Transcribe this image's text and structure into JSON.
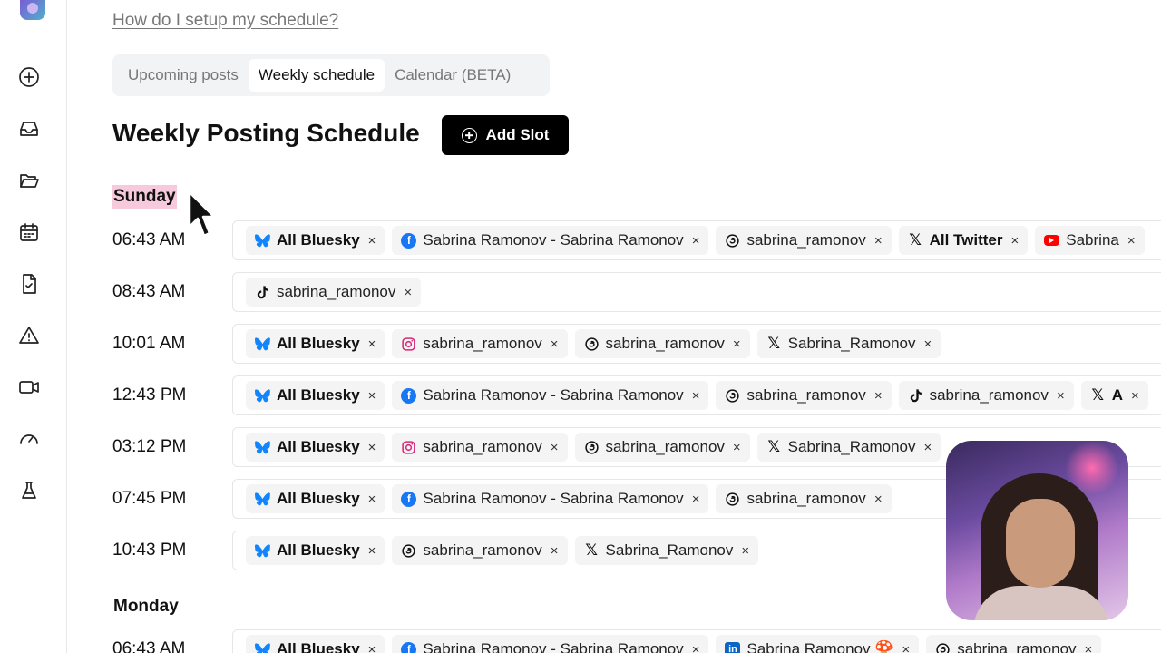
{
  "help_link": "How do I setup my schedule?",
  "tabs": [
    {
      "label": "Upcoming posts",
      "active": false
    },
    {
      "label": "Weekly schedule",
      "active": true
    },
    {
      "label": "Calendar (BETA)",
      "active": false
    }
  ],
  "page_title": "Weekly Posting Schedule",
  "add_slot_label": "Add Slot",
  "sidebar_icons": [
    "plus-circle-icon",
    "inbox-icon",
    "folder-open-icon",
    "calendar-icon",
    "file-check-icon",
    "warning-icon",
    "video-icon",
    "gauge-icon",
    "flask-icon"
  ],
  "days": [
    {
      "name": "Sunday",
      "slots": [
        {
          "time": "06:43 AM",
          "channels": [
            {
              "icon": "bluesky-icon",
              "label": "All Bluesky",
              "bold": true
            },
            {
              "icon": "facebook-icon",
              "label": "Sabrina Ramonov - Sabrina Ramonov",
              "bold": false
            },
            {
              "icon": "threads-icon",
              "label": "sabrina_ramonov",
              "bold": false
            },
            {
              "icon": "x-icon",
              "label": "All Twitter",
              "bold": true
            },
            {
              "icon": "youtube-icon",
              "label": "Sabrina",
              "bold": false
            }
          ]
        },
        {
          "time": "08:43 AM",
          "channels": [
            {
              "icon": "tiktok-icon",
              "label": "sabrina_ramonov",
              "bold": false
            }
          ]
        },
        {
          "time": "10:01 AM",
          "channels": [
            {
              "icon": "bluesky-icon",
              "label": "All Bluesky",
              "bold": true
            },
            {
              "icon": "instagram-icon",
              "label": "sabrina_ramonov",
              "bold": false
            },
            {
              "icon": "threads-icon",
              "label": "sabrina_ramonov",
              "bold": false
            },
            {
              "icon": "x-icon",
              "label": "Sabrina_Ramonov",
              "bold": false
            }
          ]
        },
        {
          "time": "12:43 PM",
          "channels": [
            {
              "icon": "bluesky-icon",
              "label": "All Bluesky",
              "bold": true
            },
            {
              "icon": "facebook-icon",
              "label": "Sabrina Ramonov - Sabrina Ramonov",
              "bold": false
            },
            {
              "icon": "threads-icon",
              "label": "sabrina_ramonov",
              "bold": false
            },
            {
              "icon": "tiktok-icon",
              "label": "sabrina_ramonov",
              "bold": false
            },
            {
              "icon": "x-icon",
              "label": "A",
              "bold": true
            }
          ]
        },
        {
          "time": "03:12 PM",
          "channels": [
            {
              "icon": "bluesky-icon",
              "label": "All Bluesky",
              "bold": true
            },
            {
              "icon": "instagram-icon",
              "label": "sabrina_ramonov",
              "bold": false
            },
            {
              "icon": "threads-icon",
              "label": "sabrina_ramonov",
              "bold": false
            },
            {
              "icon": "x-icon",
              "label": "Sabrina_Ramonov",
              "bold": false
            }
          ]
        },
        {
          "time": "07:45 PM",
          "channels": [
            {
              "icon": "bluesky-icon",
              "label": "All Bluesky",
              "bold": true
            },
            {
              "icon": "facebook-icon",
              "label": "Sabrina Ramonov - Sabrina Ramonov",
              "bold": false
            },
            {
              "icon": "threads-icon",
              "label": "sabrina_ramonov",
              "bold": false
            }
          ]
        },
        {
          "time": "10:43 PM",
          "channels": [
            {
              "icon": "bluesky-icon",
              "label": "All Bluesky",
              "bold": true
            },
            {
              "icon": "threads-icon",
              "label": "sabrina_ramonov",
              "bold": false
            },
            {
              "icon": "x-icon",
              "label": "Sabrina_Ramonov",
              "bold": false
            }
          ]
        }
      ]
    },
    {
      "name": "Monday",
      "slots": [
        {
          "time": "06:43 AM",
          "channels": [
            {
              "icon": "bluesky-icon",
              "label": "All Bluesky",
              "bold": true
            },
            {
              "icon": "facebook-icon",
              "label": "Sabrina Ramonov - Sabrina Ramonov",
              "bold": false
            },
            {
              "icon": "linkedin-icon",
              "label": "Sabrina Ramonov 🍄",
              "bold": false
            },
            {
              "icon": "threads-icon",
              "label": "sabrina_ramonov",
              "bold": false
            }
          ]
        }
      ]
    }
  ],
  "remove_glyph": "×"
}
